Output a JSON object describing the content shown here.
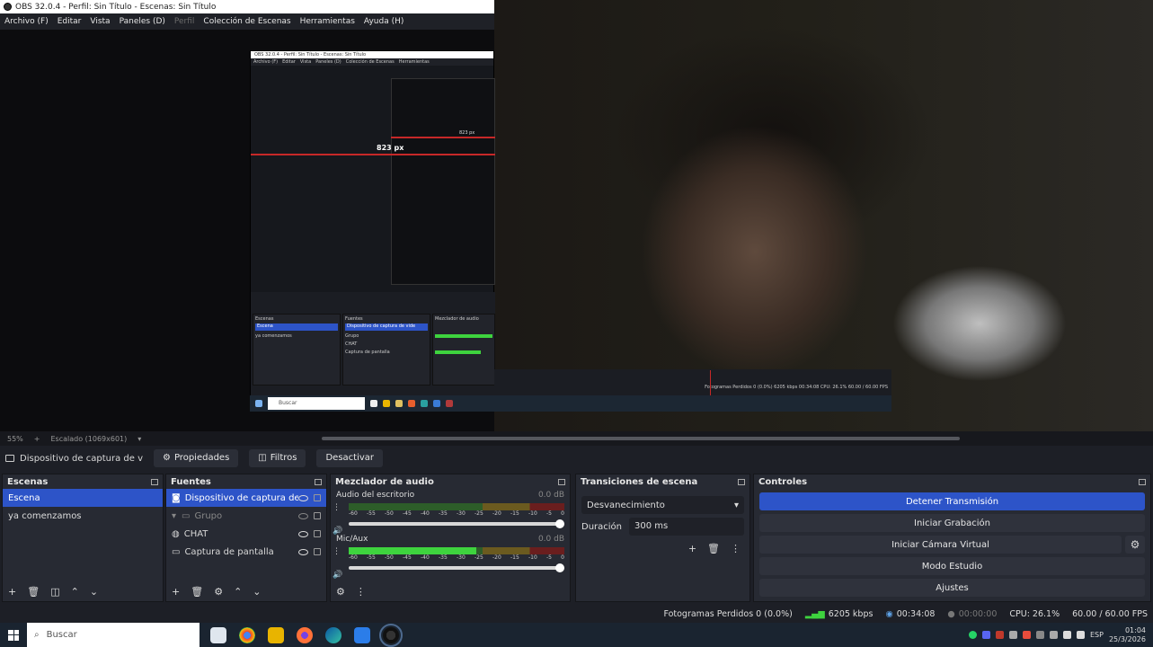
{
  "window": {
    "title": "OBS 32.0.4 - Perfil: Sin Título - Escenas: Sin Título"
  },
  "menu": [
    {
      "label": "Archivo (F)",
      "disabled": false
    },
    {
      "label": "Editar",
      "disabled": false
    },
    {
      "label": "Vista",
      "disabled": false
    },
    {
      "label": "Paneles (D)",
      "disabled": false
    },
    {
      "label": "Perfil",
      "disabled": true
    },
    {
      "label": "Colección de Escenas",
      "disabled": false
    },
    {
      "label": "Herramientas",
      "disabled": false
    },
    {
      "label": "Ayuda (H)",
      "disabled": false
    }
  ],
  "preview": {
    "nested_measure": "823 px",
    "nested_measure_small": "823 px",
    "nested_search": "Buscar",
    "nested_scenes_title": "Escenas",
    "nested_scene_1": "Escena",
    "nested_scene_2": "ya comenzamos",
    "nested_sources_title": "Fuentes",
    "nested_mixer_title": "Mezclador de audio",
    "nested_status": "Fotogramas Perdidos 0 (0.0%)   6205 kbps   00:34:08   CPU: 26.1%   60.00 / 60.00 FPS"
  },
  "zoombar": {
    "zoom": "55%",
    "scale": "Escalado (1069x601)"
  },
  "source_toolbar": {
    "selected_source": "Dispositivo de captura de v",
    "properties": "Propiedades",
    "filters": "Filtros",
    "deactivate": "Desactivar"
  },
  "scenes": {
    "title": "Escenas",
    "items": [
      "Escena",
      "ya comenzamos"
    ]
  },
  "sources": {
    "title": "Fuentes",
    "items": [
      {
        "label": "Dispositivo de captura de vide",
        "icon": "camera-icon",
        "selected": true
      },
      {
        "label": "Grupo",
        "icon": "folder-icon",
        "dim": true
      },
      {
        "label": "CHAT",
        "icon": "globe-icon"
      },
      {
        "label": "Captura de pantalla",
        "icon": "monitor-icon"
      }
    ]
  },
  "mixer": {
    "title": "Mezclador de audio",
    "ticks": [
      "-60",
      "-55",
      "-50",
      "-45",
      "-40",
      "-35",
      "-30",
      "-25",
      "-20",
      "-15",
      "-10",
      "-5",
      "0"
    ],
    "tracks": [
      {
        "name": "Audio del escritorio",
        "db": "0.0 dB",
        "level": 0
      },
      {
        "name": "Mic/Aux",
        "db": "0.0 dB",
        "level": 0.59
      }
    ]
  },
  "transitions": {
    "title": "Transiciones de escena",
    "selected": "Desvanecimiento",
    "duration_label": "Duración",
    "duration_value": "300 ms"
  },
  "controls": {
    "title": "Controles",
    "stop_stream": "Detener Transmisión",
    "start_recording": "Iniciar Grabación",
    "start_virtual_cam": "Iniciar Cámara Virtual",
    "studio_mode": "Modo Estudio",
    "settings": "Ajustes"
  },
  "status": {
    "dropped_frames": "Fotogramas Perdidos 0 (0.0%)",
    "bitrate": "6205 kbps",
    "stream_time": "00:34:08",
    "record_time": "00:00:00",
    "cpu": "CPU: 26.1%",
    "fps": "60.00 / 60.00 FPS"
  },
  "taskbar": {
    "search_placeholder": "Buscar",
    "language": "ESP",
    "time": "01:04",
    "date": "25/3/2026"
  },
  "colors": {
    "accent": "#2d54c8",
    "meter_green": "#3ed33e",
    "background": "#1d1f26"
  }
}
